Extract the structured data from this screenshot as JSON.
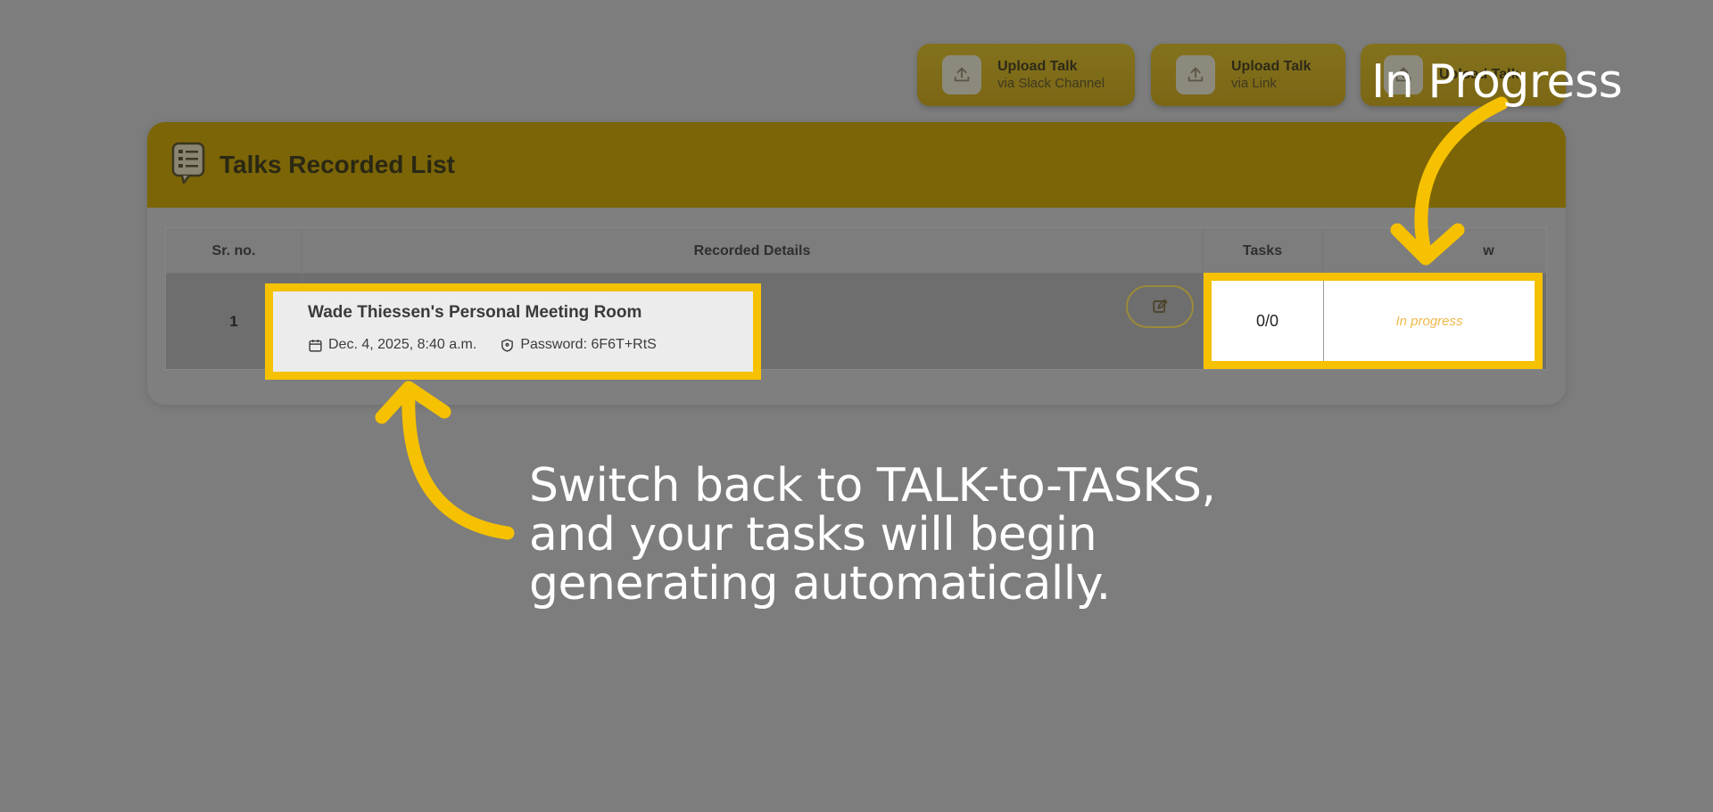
{
  "upload_buttons": [
    {
      "title": "Upload Talk",
      "subtitle": "via Slack Channel"
    },
    {
      "title": "Upload Talk",
      "subtitle": "via Link"
    },
    {
      "title": "Upload Talk",
      "subtitle": ""
    }
  ],
  "card": {
    "title": "Talks Recorded List"
  },
  "table": {
    "headers": [
      "Sr. no.",
      "Recorded Details",
      "Tasks",
      "w"
    ],
    "rows": [
      {
        "sr": "1",
        "name": "Wade Thiessen's Personal Meeting Room",
        "date": "Dec. 4, 2025, 8:40 a.m.",
        "password": "Password: 6F6T+RtS",
        "tasks": "0/0",
        "status": "In progress"
      }
    ]
  },
  "annotations": {
    "top": "In Progress",
    "main_lines": [
      "Switch back to TALK-to-TASKS,",
      "and your tasks will begin",
      "generating automatically."
    ]
  },
  "colors": {
    "highlight": "#f5c100",
    "header_gold": "#7b6507",
    "overlay": "#7c7d7c",
    "status_text": "#f0b94a"
  }
}
